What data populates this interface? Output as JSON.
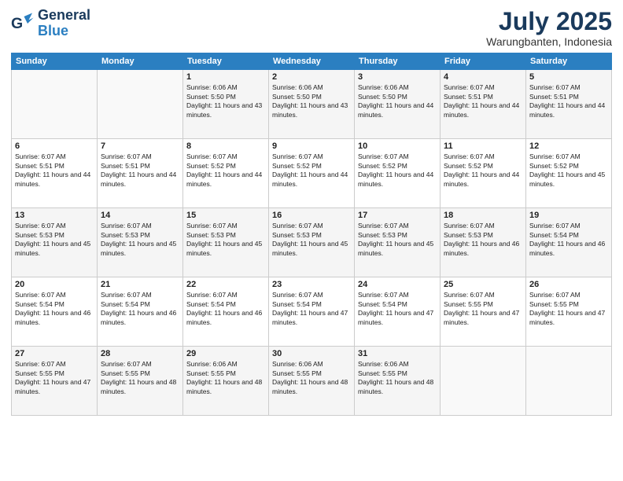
{
  "header": {
    "logo_general": "General",
    "logo_blue": "Blue",
    "month_title": "July 2025",
    "location": "Warungbanten, Indonesia"
  },
  "weekdays": [
    "Sunday",
    "Monday",
    "Tuesday",
    "Wednesday",
    "Thursday",
    "Friday",
    "Saturday"
  ],
  "weeks": [
    [
      {
        "day": "",
        "sunrise": "",
        "sunset": "",
        "daylight": ""
      },
      {
        "day": "",
        "sunrise": "",
        "sunset": "",
        "daylight": ""
      },
      {
        "day": "1",
        "sunrise": "Sunrise: 6:06 AM",
        "sunset": "Sunset: 5:50 PM",
        "daylight": "Daylight: 11 hours and 43 minutes."
      },
      {
        "day": "2",
        "sunrise": "Sunrise: 6:06 AM",
        "sunset": "Sunset: 5:50 PM",
        "daylight": "Daylight: 11 hours and 43 minutes."
      },
      {
        "day": "3",
        "sunrise": "Sunrise: 6:06 AM",
        "sunset": "Sunset: 5:50 PM",
        "daylight": "Daylight: 11 hours and 44 minutes."
      },
      {
        "day": "4",
        "sunrise": "Sunrise: 6:07 AM",
        "sunset": "Sunset: 5:51 PM",
        "daylight": "Daylight: 11 hours and 44 minutes."
      },
      {
        "day": "5",
        "sunrise": "Sunrise: 6:07 AM",
        "sunset": "Sunset: 5:51 PM",
        "daylight": "Daylight: 11 hours and 44 minutes."
      }
    ],
    [
      {
        "day": "6",
        "sunrise": "Sunrise: 6:07 AM",
        "sunset": "Sunset: 5:51 PM",
        "daylight": "Daylight: 11 hours and 44 minutes."
      },
      {
        "day": "7",
        "sunrise": "Sunrise: 6:07 AM",
        "sunset": "Sunset: 5:51 PM",
        "daylight": "Daylight: 11 hours and 44 minutes."
      },
      {
        "day": "8",
        "sunrise": "Sunrise: 6:07 AM",
        "sunset": "Sunset: 5:52 PM",
        "daylight": "Daylight: 11 hours and 44 minutes."
      },
      {
        "day": "9",
        "sunrise": "Sunrise: 6:07 AM",
        "sunset": "Sunset: 5:52 PM",
        "daylight": "Daylight: 11 hours and 44 minutes."
      },
      {
        "day": "10",
        "sunrise": "Sunrise: 6:07 AM",
        "sunset": "Sunset: 5:52 PM",
        "daylight": "Daylight: 11 hours and 44 minutes."
      },
      {
        "day": "11",
        "sunrise": "Sunrise: 6:07 AM",
        "sunset": "Sunset: 5:52 PM",
        "daylight": "Daylight: 11 hours and 44 minutes."
      },
      {
        "day": "12",
        "sunrise": "Sunrise: 6:07 AM",
        "sunset": "Sunset: 5:52 PM",
        "daylight": "Daylight: 11 hours and 45 minutes."
      }
    ],
    [
      {
        "day": "13",
        "sunrise": "Sunrise: 6:07 AM",
        "sunset": "Sunset: 5:53 PM",
        "daylight": "Daylight: 11 hours and 45 minutes."
      },
      {
        "day": "14",
        "sunrise": "Sunrise: 6:07 AM",
        "sunset": "Sunset: 5:53 PM",
        "daylight": "Daylight: 11 hours and 45 minutes."
      },
      {
        "day": "15",
        "sunrise": "Sunrise: 6:07 AM",
        "sunset": "Sunset: 5:53 PM",
        "daylight": "Daylight: 11 hours and 45 minutes."
      },
      {
        "day": "16",
        "sunrise": "Sunrise: 6:07 AM",
        "sunset": "Sunset: 5:53 PM",
        "daylight": "Daylight: 11 hours and 45 minutes."
      },
      {
        "day": "17",
        "sunrise": "Sunrise: 6:07 AM",
        "sunset": "Sunset: 5:53 PM",
        "daylight": "Daylight: 11 hours and 45 minutes."
      },
      {
        "day": "18",
        "sunrise": "Sunrise: 6:07 AM",
        "sunset": "Sunset: 5:53 PM",
        "daylight": "Daylight: 11 hours and 46 minutes."
      },
      {
        "day": "19",
        "sunrise": "Sunrise: 6:07 AM",
        "sunset": "Sunset: 5:54 PM",
        "daylight": "Daylight: 11 hours and 46 minutes."
      }
    ],
    [
      {
        "day": "20",
        "sunrise": "Sunrise: 6:07 AM",
        "sunset": "Sunset: 5:54 PM",
        "daylight": "Daylight: 11 hours and 46 minutes."
      },
      {
        "day": "21",
        "sunrise": "Sunrise: 6:07 AM",
        "sunset": "Sunset: 5:54 PM",
        "daylight": "Daylight: 11 hours and 46 minutes."
      },
      {
        "day": "22",
        "sunrise": "Sunrise: 6:07 AM",
        "sunset": "Sunset: 5:54 PM",
        "daylight": "Daylight: 11 hours and 46 minutes."
      },
      {
        "day": "23",
        "sunrise": "Sunrise: 6:07 AM",
        "sunset": "Sunset: 5:54 PM",
        "daylight": "Daylight: 11 hours and 47 minutes."
      },
      {
        "day": "24",
        "sunrise": "Sunrise: 6:07 AM",
        "sunset": "Sunset: 5:54 PM",
        "daylight": "Daylight: 11 hours and 47 minutes."
      },
      {
        "day": "25",
        "sunrise": "Sunrise: 6:07 AM",
        "sunset": "Sunset: 5:55 PM",
        "daylight": "Daylight: 11 hours and 47 minutes."
      },
      {
        "day": "26",
        "sunrise": "Sunrise: 6:07 AM",
        "sunset": "Sunset: 5:55 PM",
        "daylight": "Daylight: 11 hours and 47 minutes."
      }
    ],
    [
      {
        "day": "27",
        "sunrise": "Sunrise: 6:07 AM",
        "sunset": "Sunset: 5:55 PM",
        "daylight": "Daylight: 11 hours and 47 minutes."
      },
      {
        "day": "28",
        "sunrise": "Sunrise: 6:07 AM",
        "sunset": "Sunset: 5:55 PM",
        "daylight": "Daylight: 11 hours and 48 minutes."
      },
      {
        "day": "29",
        "sunrise": "Sunrise: 6:06 AM",
        "sunset": "Sunset: 5:55 PM",
        "daylight": "Daylight: 11 hours and 48 minutes."
      },
      {
        "day": "30",
        "sunrise": "Sunrise: 6:06 AM",
        "sunset": "Sunset: 5:55 PM",
        "daylight": "Daylight: 11 hours and 48 minutes."
      },
      {
        "day": "31",
        "sunrise": "Sunrise: 6:06 AM",
        "sunset": "Sunset: 5:55 PM",
        "daylight": "Daylight: 11 hours and 48 minutes."
      },
      {
        "day": "",
        "sunrise": "",
        "sunset": "",
        "daylight": ""
      },
      {
        "day": "",
        "sunrise": "",
        "sunset": "",
        "daylight": ""
      }
    ]
  ]
}
